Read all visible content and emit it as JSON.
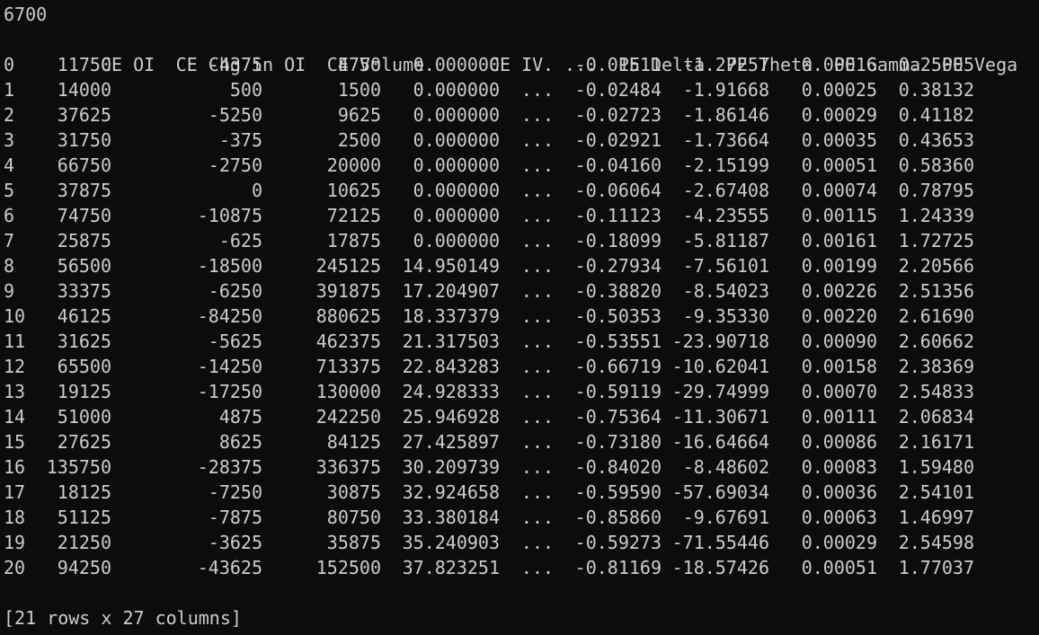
{
  "top_line": "6700",
  "columns": {
    "index": "",
    "ce_oi": "CE OI",
    "ce_chg_in_oi": "CE Chg in OI",
    "ce_volume": "CE Volume",
    "ce_iv": "CE IV",
    "ellipsis": "...",
    "pe_delta": "PE Delta",
    "pe_theta": "PE Theta",
    "pe_gamma": "PE Gamma",
    "pe_vega": "PE Vega"
  },
  "rows": [
    {
      "index": "0",
      "ce_oi": "11750",
      "ce_chg_in_oi": "-4375",
      "ce_volume": "4750",
      "ce_iv": "0.000000",
      "ellipsis": "...",
      "pe_delta": "-0.01511",
      "pe_theta": "-1.27257",
      "pe_gamma": "0.00016",
      "pe_vega": "0.25005"
    },
    {
      "index": "1",
      "ce_oi": "14000",
      "ce_chg_in_oi": "500",
      "ce_volume": "1500",
      "ce_iv": "0.000000",
      "ellipsis": "...",
      "pe_delta": "-0.02484",
      "pe_theta": "-1.91668",
      "pe_gamma": "0.00025",
      "pe_vega": "0.38132"
    },
    {
      "index": "2",
      "ce_oi": "37625",
      "ce_chg_in_oi": "-5250",
      "ce_volume": "9625",
      "ce_iv": "0.000000",
      "ellipsis": "...",
      "pe_delta": "-0.02723",
      "pe_theta": "-1.86146",
      "pe_gamma": "0.00029",
      "pe_vega": "0.41182"
    },
    {
      "index": "3",
      "ce_oi": "31750",
      "ce_chg_in_oi": "-375",
      "ce_volume": "2500",
      "ce_iv": "0.000000",
      "ellipsis": "...",
      "pe_delta": "-0.02921",
      "pe_theta": "-1.73664",
      "pe_gamma": "0.00035",
      "pe_vega": "0.43653"
    },
    {
      "index": "4",
      "ce_oi": "66750",
      "ce_chg_in_oi": "-2750",
      "ce_volume": "20000",
      "ce_iv": "0.000000",
      "ellipsis": "...",
      "pe_delta": "-0.04160",
      "pe_theta": "-2.15199",
      "pe_gamma": "0.00051",
      "pe_vega": "0.58360"
    },
    {
      "index": "5",
      "ce_oi": "37875",
      "ce_chg_in_oi": "0",
      "ce_volume": "10625",
      "ce_iv": "0.000000",
      "ellipsis": "...",
      "pe_delta": "-0.06064",
      "pe_theta": "-2.67408",
      "pe_gamma": "0.00074",
      "pe_vega": "0.78795"
    },
    {
      "index": "6",
      "ce_oi": "74750",
      "ce_chg_in_oi": "-10875",
      "ce_volume": "72125",
      "ce_iv": "0.000000",
      "ellipsis": "...",
      "pe_delta": "-0.11123",
      "pe_theta": "-4.23555",
      "pe_gamma": "0.00115",
      "pe_vega": "1.24339"
    },
    {
      "index": "7",
      "ce_oi": "25875",
      "ce_chg_in_oi": "-625",
      "ce_volume": "17875",
      "ce_iv": "0.000000",
      "ellipsis": "...",
      "pe_delta": "-0.18099",
      "pe_theta": "-5.81187",
      "pe_gamma": "0.00161",
      "pe_vega": "1.72725"
    },
    {
      "index": "8",
      "ce_oi": "56500",
      "ce_chg_in_oi": "-18500",
      "ce_volume": "245125",
      "ce_iv": "14.950149",
      "ellipsis": "...",
      "pe_delta": "-0.27934",
      "pe_theta": "-7.56101",
      "pe_gamma": "0.00199",
      "pe_vega": "2.20566"
    },
    {
      "index": "9",
      "ce_oi": "33375",
      "ce_chg_in_oi": "-6250",
      "ce_volume": "391875",
      "ce_iv": "17.204907",
      "ellipsis": "...",
      "pe_delta": "-0.38820",
      "pe_theta": "-8.54023",
      "pe_gamma": "0.00226",
      "pe_vega": "2.51356"
    },
    {
      "index": "10",
      "ce_oi": "46125",
      "ce_chg_in_oi": "-84250",
      "ce_volume": "880625",
      "ce_iv": "18.337379",
      "ellipsis": "...",
      "pe_delta": "-0.50353",
      "pe_theta": "-9.35330",
      "pe_gamma": "0.00220",
      "pe_vega": "2.61690"
    },
    {
      "index": "11",
      "ce_oi": "31625",
      "ce_chg_in_oi": "-5625",
      "ce_volume": "462375",
      "ce_iv": "21.317503",
      "ellipsis": "...",
      "pe_delta": "-0.53551",
      "pe_theta": "-23.90718",
      "pe_gamma": "0.00090",
      "pe_vega": "2.60662"
    },
    {
      "index": "12",
      "ce_oi": "65500",
      "ce_chg_in_oi": "-14250",
      "ce_volume": "713375",
      "ce_iv": "22.843283",
      "ellipsis": "...",
      "pe_delta": "-0.66719",
      "pe_theta": "-10.62041",
      "pe_gamma": "0.00158",
      "pe_vega": "2.38369"
    },
    {
      "index": "13",
      "ce_oi": "19125",
      "ce_chg_in_oi": "-17250",
      "ce_volume": "130000",
      "ce_iv": "24.928333",
      "ellipsis": "...",
      "pe_delta": "-0.59119",
      "pe_theta": "-29.74999",
      "pe_gamma": "0.00070",
      "pe_vega": "2.54833"
    },
    {
      "index": "14",
      "ce_oi": "51000",
      "ce_chg_in_oi": "4875",
      "ce_volume": "242250",
      "ce_iv": "25.946928",
      "ellipsis": "...",
      "pe_delta": "-0.75364",
      "pe_theta": "-11.30671",
      "pe_gamma": "0.00111",
      "pe_vega": "2.06834"
    },
    {
      "index": "15",
      "ce_oi": "27625",
      "ce_chg_in_oi": "8625",
      "ce_volume": "84125",
      "ce_iv": "27.425897",
      "ellipsis": "...",
      "pe_delta": "-0.73180",
      "pe_theta": "-16.64664",
      "pe_gamma": "0.00086",
      "pe_vega": "2.16171"
    },
    {
      "index": "16",
      "ce_oi": "135750",
      "ce_chg_in_oi": "-28375",
      "ce_volume": "336375",
      "ce_iv": "30.209739",
      "ellipsis": "...",
      "pe_delta": "-0.84020",
      "pe_theta": "-8.48602",
      "pe_gamma": "0.00083",
      "pe_vega": "1.59480"
    },
    {
      "index": "17",
      "ce_oi": "18125",
      "ce_chg_in_oi": "-7250",
      "ce_volume": "30875",
      "ce_iv": "32.924658",
      "ellipsis": "...",
      "pe_delta": "-0.59590",
      "pe_theta": "-57.69034",
      "pe_gamma": "0.00036",
      "pe_vega": "2.54101"
    },
    {
      "index": "18",
      "ce_oi": "51125",
      "ce_chg_in_oi": "-7875",
      "ce_volume": "80750",
      "ce_iv": "33.380184",
      "ellipsis": "...",
      "pe_delta": "-0.85860",
      "pe_theta": "-9.67691",
      "pe_gamma": "0.00063",
      "pe_vega": "1.46997"
    },
    {
      "index": "19",
      "ce_oi": "21250",
      "ce_chg_in_oi": "-3625",
      "ce_volume": "35875",
      "ce_iv": "35.240903",
      "ellipsis": "...",
      "pe_delta": "-0.59273",
      "pe_theta": "-71.55446",
      "pe_gamma": "0.00029",
      "pe_vega": "2.54598"
    },
    {
      "index": "20",
      "ce_oi": "94250",
      "ce_chg_in_oi": "-43625",
      "ce_volume": "152500",
      "ce_iv": "37.823251",
      "ellipsis": "...",
      "pe_delta": "-0.81169",
      "pe_theta": "-18.57426",
      "pe_gamma": "0.00051",
      "pe_vega": "1.77037"
    }
  ],
  "footer": "[21 rows x 27 columns]",
  "colors": {
    "background": "#0c0c0c",
    "foreground": "#cccccc"
  }
}
